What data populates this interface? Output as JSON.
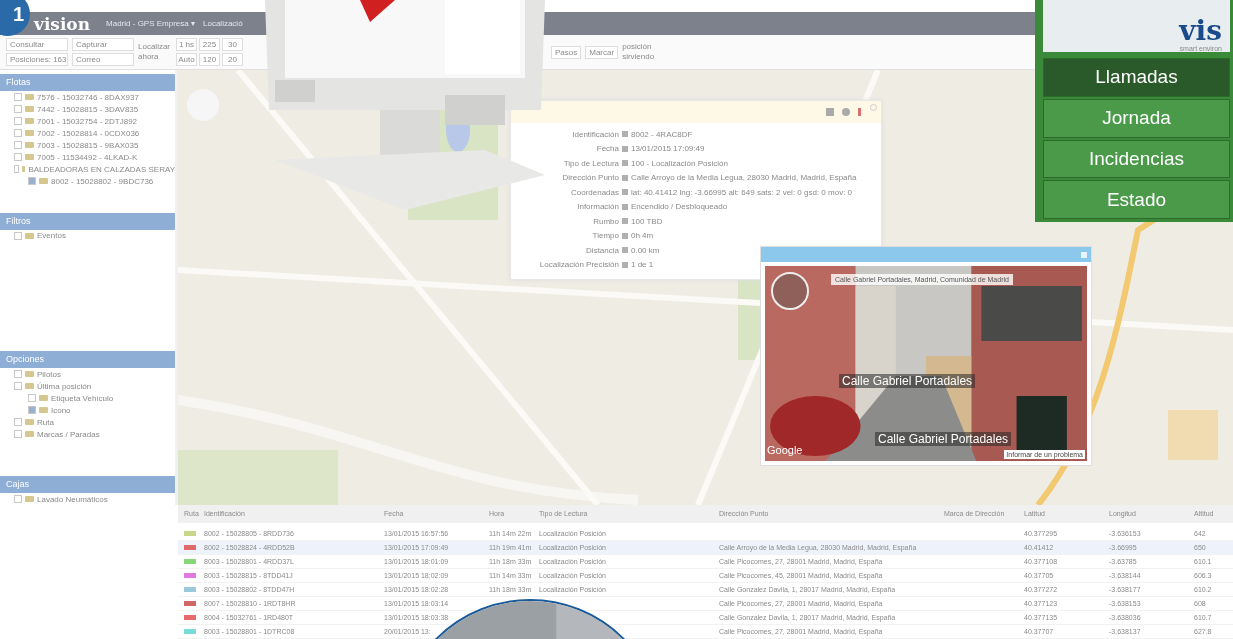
{
  "badge": "1",
  "header": {
    "logo": "vision",
    "location": "Madrid - GPS Empresa ▾",
    "menu": "Localizació"
  },
  "toolbar": {
    "groups": [
      {
        "kind": "stack",
        "items": [
          "Consultar",
          "Posiciones: 163"
        ]
      },
      {
        "kind": "stack",
        "items": [
          "Capturar",
          "Correo"
        ]
      },
      {
        "kind": "label",
        "items": [
          "Localizar ahora"
        ]
      },
      {
        "kind": "grid",
        "items": [
          "1 hs",
          "225",
          "30",
          "Auto",
          "120",
          "20"
        ]
      }
    ],
    "right": [
      {
        "kind": "button",
        "label": "Pasos"
      },
      {
        "kind": "button",
        "label": "Marcar"
      },
      {
        "kind": "note",
        "label": "posición sirviendo"
      }
    ]
  },
  "sidebar": {
    "sections": [
      {
        "title": "Flotas",
        "kind": "tree",
        "items": [
          {
            "label": "7576 - 15032746 - 8DAX937",
            "checked": false
          },
          {
            "label": "7442 - 15028815 - 3DAV835",
            "checked": false
          },
          {
            "label": "7001 - 15032754 - 2DTJ892",
            "checked": false
          },
          {
            "label": "7002 - 15028814 - 0CDX036",
            "checked": false
          },
          {
            "label": "7003 - 15028815 - 9BAX035",
            "checked": false
          },
          {
            "label": "7005 - 11534492 - 4LKAD-K",
            "checked": false
          },
          {
            "label": "BALDEADORAS EN CALZADAS SERAY",
            "checked": false,
            "children": [
              {
                "label": "8002 - 15028802 - 9BDC736",
                "checked": true
              }
            ]
          }
        ]
      },
      {
        "title": "Filtros",
        "kind": "tree",
        "items": [
          {
            "label": "Eventos",
            "checked": false
          }
        ]
      },
      {
        "title": "Opciones",
        "kind": "tree",
        "items": [
          {
            "label": "Pilotos",
            "checked": false
          },
          {
            "label": "Última posición",
            "checked": false,
            "children": [
              {
                "label": "Etiqueta Vehículo",
                "checked": false
              },
              {
                "label": "Icono",
                "checked": true
              }
            ]
          },
          {
            "label": "Ruta",
            "checked": false
          },
          {
            "label": "Marcas / Paradas",
            "checked": false
          }
        ]
      },
      {
        "title": "Cajas",
        "kind": "tree",
        "items": [
          {
            "label": "Lavado Neumáticos",
            "checked": false
          }
        ]
      }
    ]
  },
  "info_popup": {
    "rows": [
      {
        "label": "Identificación",
        "value": "8002 - 4RAC8DF"
      },
      {
        "label": "Fecha",
        "value": "13/01/2015 17:09:49"
      },
      {
        "label": "Tipo de Lectura",
        "value": "100 - Localización Posición"
      },
      {
        "label": "Dirección Punto",
        "value": "Calle Arroyo de la Media Legua, 28030 Madrid, Madrid, España"
      },
      {
        "label": "Coordenadas",
        "value": "lat: 40.41412 lng: -3.66995 alt: 649 sats: 2 vel: 0 gsd: 0 mov: 0"
      },
      {
        "label": "Información",
        "value": "Encendido / Desbloqueado"
      },
      {
        "label": "Rumbo",
        "value": "100 TBD"
      },
      {
        "label": "Tiempo",
        "value": "0h 4m"
      },
      {
        "label": "Distancia",
        "value": "0.00 km"
      },
      {
        "label": "Localización Precisión",
        "value": "1 de 1"
      }
    ]
  },
  "street_view": {
    "address": "Calle Gabriel Portadales, Madrid, Comunidad de Madrid",
    "street_labels": [
      "Calle Gabriel Portadales",
      "Calle Gabriel Portadales"
    ],
    "provider": "Google",
    "report": "Informar de un problema"
  },
  "table": {
    "columns": [
      "Ruta",
      "Identificación",
      "Fecha",
      "Hora",
      "Tipo de Lectura",
      "Dirección Punto",
      "Marca de Dirección",
      "Latitud",
      "Longitud",
      "Altitud"
    ],
    "rows": [
      {
        "color": "#c8d88a",
        "selected": false,
        "id": "8002 - 15028805 - 8RDD736",
        "fecha": "13/01/2015 16:57:56",
        "hora": "11h 14m 22m",
        "tipo": "Localización Posición",
        "latitud": "40.377295",
        "longitud": "-3.636153",
        "altitud": "642"
      },
      {
        "color": "#e06a6a",
        "selected": true,
        "id": "8002 - 15028824 - 4RDD52B",
        "fecha": "13/01/2015 17:09:49",
        "hora": "11h 19m 41m",
        "tipo": "Localización Posición",
        "direccion": "Calle Arroyo de la Media Legua, 28030 Madrid, Madrid, España",
        "latitud": "40.41412",
        "longitud": "-3.66995",
        "altitud": "650"
      },
      {
        "color": "#88d67a",
        "selected": false,
        "id": "8003 - 15028801 - 4RDD37L",
        "fecha": "13/01/2015 18:01:09",
        "hora": "11h 18m 33m",
        "tipo": "Localización Posición",
        "direccion": "Calle Picocomes, 27, 28001 Madrid, Madrid, España",
        "latitud": "40.377108",
        "longitud": "-3.63785",
        "altitud": "610.1"
      },
      {
        "color": "#e07ae0",
        "selected": false,
        "id": "8003 - 15028815 - 8TDD41J",
        "fecha": "13/01/2015 18:02:09",
        "hora": "11h 14m 33m",
        "tipo": "Localización Posición",
        "direccion": "Calle Picocomes, 45, 28001 Madrid, Madrid, España",
        "latitud": "40.37705",
        "longitud": "-3.638144",
        "altitud": "606.3"
      },
      {
        "color": "#9cc8dc",
        "selected": false,
        "id": "8003 - 15028802 - 8TDD47H",
        "fecha": "13/01/2015 18:02:28",
        "hora": "11h 18m 33m",
        "tipo": "Localización Posición",
        "direccion": "Calle Gonzalez Davila, 1, 28017 Madrid, Madrid, España",
        "latitud": "40.377272",
        "longitud": "-3.638177",
        "altitud": "610.2"
      },
      {
        "color": "#d06666",
        "selected": false,
        "id": "8007 - 15028810 - 1RDT8HR",
        "fecha": "13/01/2015 18:03:14",
        "direccion": "Calle Picocomes, 27, 28001 Madrid, Madrid, España",
        "latitud": "40.377123",
        "longitud": "-3.638153",
        "altitud": "608"
      },
      {
        "color": "#e86a6a",
        "selected": false,
        "id": "8004 - 15032761 - 1RD480T",
        "fecha": "13/01/2015 18:03:38",
        "direccion": "Calle Gonzalez Davila, 1, 28017 Madrid, Madrid, España",
        "latitud": "40.377135",
        "longitud": "-3.638036",
        "altitud": "610.7"
      },
      {
        "color": "#7adcd8",
        "selected": false,
        "id": "8003 - 15028801 - 1DTRC08",
        "fecha": "20/01/2015 13:",
        "direccion": "Calle Picocomes, 27, 28001 Madrid, Madrid, España",
        "latitud": "40.37707",
        "longitud": "-3.638137",
        "altitud": "627.8"
      }
    ]
  },
  "promo_panel": {
    "logo": "vis",
    "tagline": "smart environ",
    "buttons": [
      {
        "label": "Llamadas",
        "selected": true
      },
      {
        "label": "Jornada",
        "selected": false
      },
      {
        "label": "Incidencias",
        "selected": false
      },
      {
        "label": "Estado",
        "selected": false
      }
    ]
  }
}
